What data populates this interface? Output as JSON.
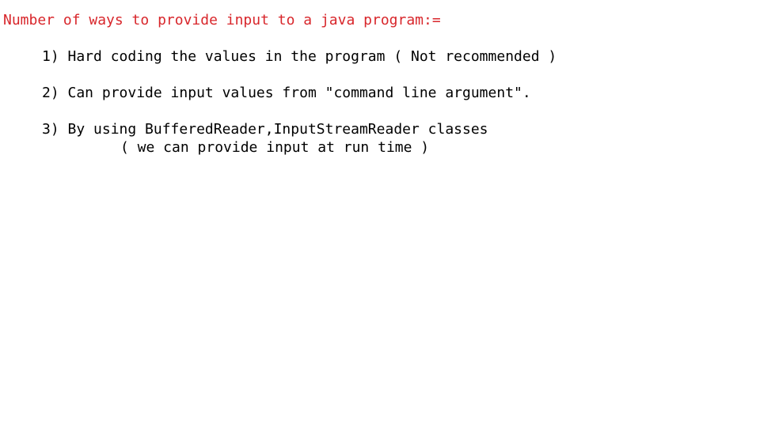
{
  "document": {
    "heading": "Number of ways to provide input to a java program:=",
    "heading_color": "#d8262b",
    "items": [
      {
        "text": "1) Hard coding the values in the program ( Not recommended )"
      },
      {
        "text": "2) Can provide input values from \"command line argument\"."
      },
      {
        "text": "3) By using BufferedReader,InputStreamReader classes",
        "note": "( we can provide input at run time )"
      }
    ]
  }
}
